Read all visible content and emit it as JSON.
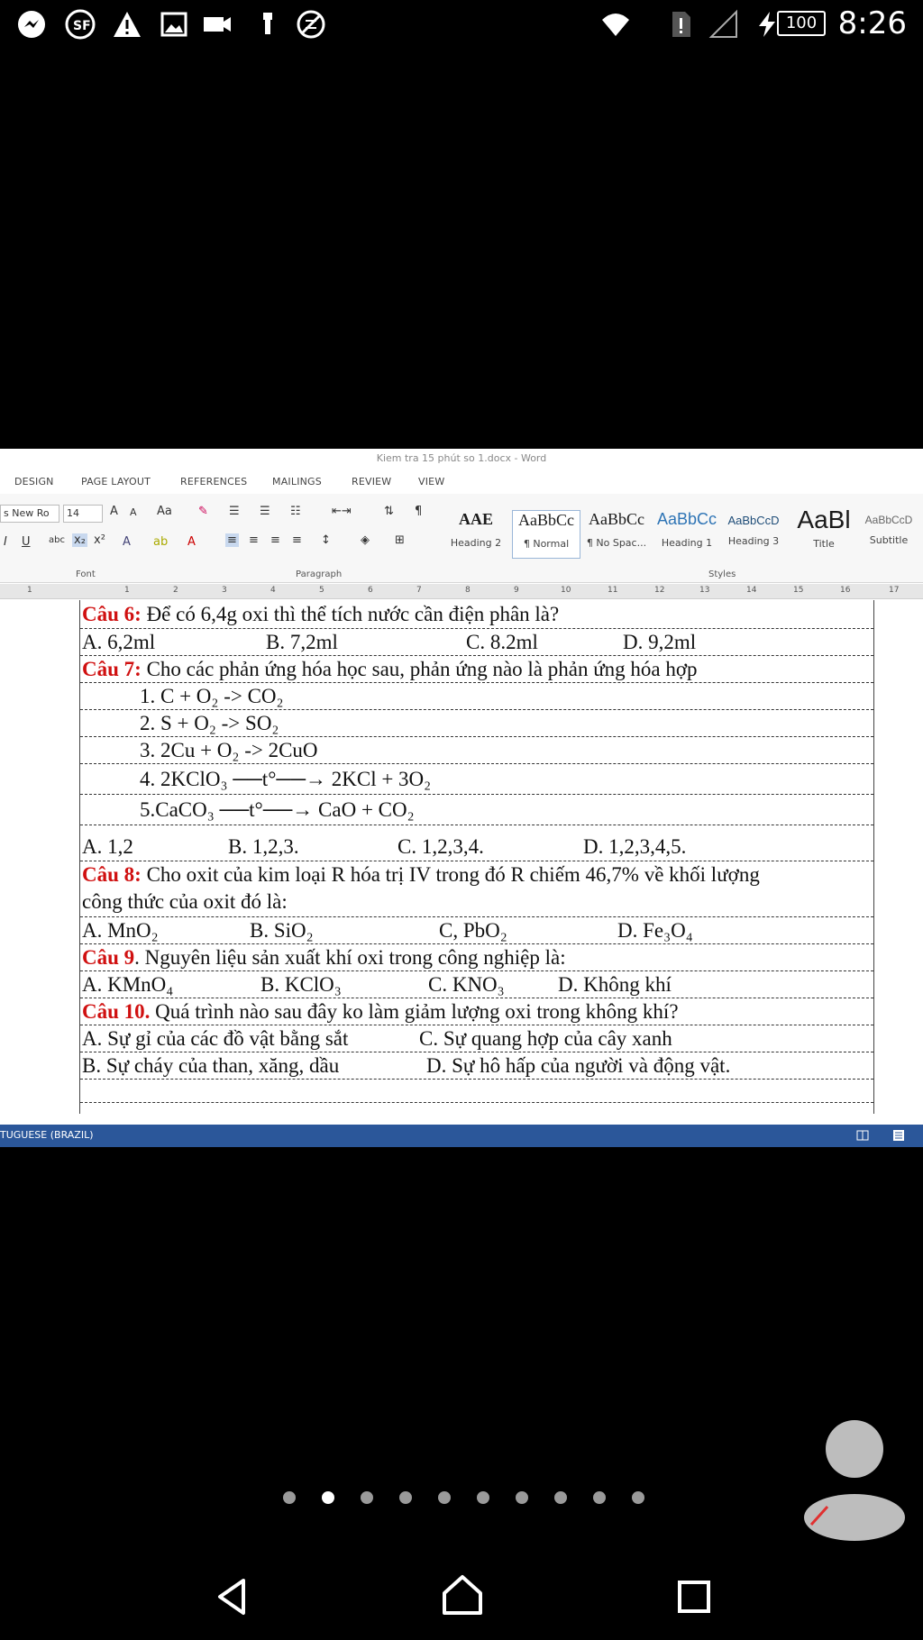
{
  "status_bar": {
    "icons": [
      "messenger-icon",
      "sf-icon",
      "warning-icon",
      "image-icon",
      "video-icon",
      "usb-icon",
      "blocked-data-icon"
    ],
    "right_icons": [
      "wifi-icon",
      "sim-alert-icon",
      "signal-icon",
      "charging-icon"
    ],
    "battery": "100",
    "time": "8:26"
  },
  "word": {
    "title": "Kiem tra 15 phút so 1.docx - Word",
    "tabs": [
      "DESIGN",
      "PAGE LAYOUT",
      "REFERENCES",
      "MAILINGS",
      "REVIEW",
      "VIEW"
    ],
    "font_name": "s New Ro",
    "font_size": "14",
    "group_font": "Font",
    "group_paragraph": "Paragraph",
    "group_styles": "Styles",
    "styles": [
      {
        "sample": "AAE",
        "name": "Heading 2"
      },
      {
        "sample": "AaBbCc",
        "name": "¶ Normal"
      },
      {
        "sample": "AaBbCc",
        "name": "¶ No Spac..."
      },
      {
        "sample": "AaBbCc",
        "name": "Heading 1"
      },
      {
        "sample": "AaBbCcD",
        "name": "Heading 3"
      },
      {
        "sample": "AaBl",
        "name": "Title"
      },
      {
        "sample": "AaBbCcD",
        "name": "Subtitle"
      }
    ],
    "ruler_ticks": [
      "1",
      "1",
      "2",
      "3",
      "4",
      "5",
      "6",
      "7",
      "8",
      "9",
      "10",
      "11",
      "12",
      "13",
      "14",
      "15",
      "16",
      "17"
    ],
    "language": "TUGUESE (BRAZIL)"
  },
  "document": {
    "q6": {
      "label": "Câu 6:",
      "text": " Để có 6,4g oxi thì thể tích nước cần điện phân là?",
      "options": [
        "A.  6,2ml",
        "B. 7,2ml",
        "C. 8.2ml",
        "D. 9,2ml"
      ]
    },
    "q7": {
      "label": "Câu 7:",
      "text": " Cho các phản ứng hóa học sau, phản ứng nào là phản ứng hóa hợp",
      "reactions": [
        "1. C  +  O₂  ->  CO₂",
        "2.  S + O₂  -> SO₂",
        "3. 2Cu + O₂  ->  2CuO",
        "4. 2KClO₃   ──t°──→  2KCl  + 3O₂",
        "5.CaCO₃   ──t°──→  CaO + CO₂"
      ],
      "options": [
        "A. 1,2",
        "B. 1,2,3.",
        "C. 1,2,3,4.",
        "D. 1,2,3,4,5."
      ]
    },
    "q8": {
      "label": "Câu 8:",
      "text": " Cho oxit của kim loại R hóa trị IV trong đó R chiếm 46,7% về khối lượng",
      "line2": "công thức của oxit đó là:",
      "options": [
        "A. MnO₂",
        "B. SiO₂",
        "C, PbO₂",
        "D. Fe₃O₄"
      ]
    },
    "q9": {
      "label": "Câu 9",
      "text": ". Nguyên liệu sản xuất khí oxi trong công nghiệp là:",
      "options": [
        "A. KMnO₄",
        "B. KClO₃",
        "C. KNO₃",
        "D. Không khí"
      ]
    },
    "q10": {
      "label": "Câu 10.",
      "text": " Quá trình nào sau đây ko làm giảm lượng oxi trong không khí?",
      "line2_a": "A. Sự  gỉ của các đồ vật bằng sắt",
      "line2_c": "C. Sự  quang hợp của cây xanh",
      "line3_b": "B. Sự cháy của than, xăng, dầu",
      "line3_d": "D. Sự hô hấp của người và động vật."
    }
  },
  "pager": {
    "count": 10,
    "active_index": 1
  },
  "nav": [
    "back-icon",
    "home-icon",
    "recents-icon"
  ]
}
